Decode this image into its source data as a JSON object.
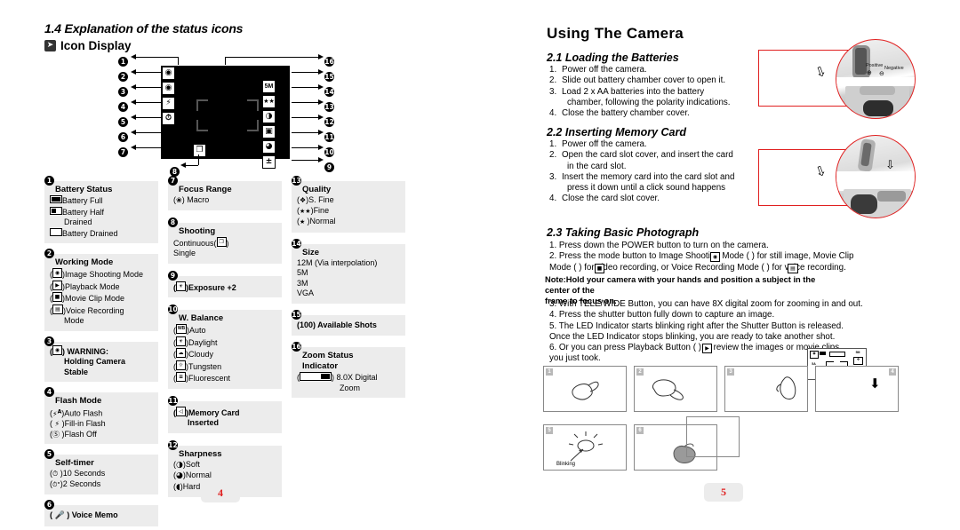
{
  "left_page": {
    "section_title": "1.4 Explanation of the status icons",
    "subsection_icon_name": "book-icon",
    "subsection_title": "Icon Display",
    "lcd": {
      "left_icons": [
        "camera-icon",
        "hand-shake-camera-icon",
        "flash-auto-icon",
        "self-timer-icon"
      ],
      "left_icon_labels": [
        "■",
        "■",
        "᭺",
        "◔"
      ],
      "right_icon_labels": [
        "5M",
        "★★",
        "◑",
        "◧",
        "◕",
        "±"
      ],
      "bottom_icon_label": "❐",
      "callouts": [
        "1",
        "2",
        "3",
        "4",
        "5",
        "6",
        "7",
        "8",
        "9",
        "10",
        "11",
        "12",
        "13",
        "14",
        "15",
        "16"
      ]
    },
    "page_number": "4",
    "legend": [
      {
        "num": "1",
        "title": "Battery Status",
        "rows": [
          {
            "icon": "battery-full-icon",
            "icon_fill": 100,
            "text": "Battery Full"
          },
          {
            "icon": "battery-half-icon",
            "icon_fill": 50,
            "text": "Battery Half"
          },
          {
            "icon": "",
            "indent": true,
            "text": "Drained"
          },
          {
            "icon": "battery-empty-icon",
            "icon_fill": 0,
            "text": "Battery Drained"
          }
        ]
      },
      {
        "num": "2",
        "title": "Working Mode",
        "rows": [
          {
            "icon": "image-shooting-mode-icon",
            "glyph": "■",
            "text": "Image Shooting Mode"
          },
          {
            "icon": "playback-mode-icon",
            "glyph": "▶",
            "text": "Playback  Mode"
          },
          {
            "icon": "movie-clip-mode-icon",
            "glyph": "Ἲ5",
            "text": "Movie Clip Mode"
          },
          {
            "icon": "voice-recording-mode-icon",
            "glyph": "▭",
            "text": "Voice Recording"
          },
          {
            "icon": "",
            "indent": true,
            "text": "Mode"
          }
        ]
      },
      {
        "num": "3",
        "title": "WARNING:",
        "title_icon": "holding-camera-warning-icon",
        "title_inline": true,
        "rows": [
          {
            "icon": "",
            "indent": true,
            "bold": true,
            "text": "Holding Camera"
          },
          {
            "icon": "",
            "indent": true,
            "bold": true,
            "text": "Stable"
          }
        ]
      },
      {
        "num": "4",
        "title": "Flash Mode",
        "rows": [
          {
            "icon": "flash-auto-icon",
            "glyph": "⚡A",
            "text": "Auto Flash",
            "plain": true
          },
          {
            "icon": "flash-fill-icon",
            "glyph": "⚡",
            "text": "Fill-in Flash",
            "plain": true
          },
          {
            "icon": "flash-off-icon",
            "glyph": "ⓘ",
            "text": "Flash Off",
            "plain": true
          }
        ]
      },
      {
        "num": "5",
        "title": "Self-timer",
        "rows": [
          {
            "icon": "timer-10s-icon",
            "glyph": "◴",
            "text": "10 Seconds",
            "plain": true
          },
          {
            "icon": "timer-2s-icon",
            "glyph": "◴\"",
            "text": "2 Seconds",
            "plain": true
          }
        ]
      },
      {
        "num": "6",
        "title": "Voice Memo",
        "title_icon": "microphone-icon",
        "title_inline": true,
        "rows": []
      },
      {
        "num": "7",
        "title": "Focus Range",
        "rows": [
          {
            "icon": "macro-flower-icon",
            "glyph": "❀",
            "text": " Macro",
            "plain": true
          }
        ]
      },
      {
        "num": "8",
        "title": "Shooting",
        "rows": [
          {
            "icon": "continuous-shooting-icon",
            "text": "Continuous",
            "suffix_icon": true,
            "suffix_glyph": "⧉"
          },
          {
            "icon": "",
            "text": "Single",
            "noparen": true
          }
        ]
      },
      {
        "num": "9",
        "title": "Exposure +2",
        "title_icon": "exposure-icon",
        "title_inline": true,
        "rows": []
      },
      {
        "num": "10",
        "title": "W. Balance",
        "rows": [
          {
            "icon": "wb-auto-icon",
            "glyph": "WB",
            "text": "Auto"
          },
          {
            "icon": "wb-daylight-icon",
            "glyph": "☀",
            "text": "Daylight"
          },
          {
            "icon": "wb-cloudy-icon",
            "glyph": "☁",
            "text": "Cloudy"
          },
          {
            "icon": "wb-tungsten-icon",
            "glyph": "Ὂ1",
            "text": "Tungsten"
          },
          {
            "icon": "wb-fluorescent-icon",
            "glyph": "≡",
            "text": "Fluorescent"
          }
        ]
      },
      {
        "num": "11",
        "title": "Memory Card",
        "title_icon": "memory-card-icon",
        "title_inline": true,
        "rows": [
          {
            "icon": "",
            "indent": true,
            "bold": true,
            "text": "Inserted"
          }
        ]
      },
      {
        "num": "12",
        "title": "Sharpness",
        "rows": [
          {
            "icon": "sharpness-soft-icon",
            "glyph": "◑",
            "text": "Soft"
          },
          {
            "icon": "sharpness-normal-icon",
            "glyph": "◔",
            "text": "Normal"
          },
          {
            "icon": "sharpness-hard-icon",
            "glyph": "◕",
            "text": "Hard"
          }
        ]
      },
      {
        "num": "13",
        "title": "Quality",
        "rows": [
          {
            "icon": "quality-super-fine-icon",
            "glyph": "✶",
            "text": "S. Fine"
          },
          {
            "icon": "quality-fine-icon",
            "glyph": "★★",
            "text": "Fine",
            "noborder": true
          },
          {
            "icon": "quality-normal-icon",
            "glyph": "★ ",
            "text": "Normal",
            "noborder": true
          }
        ]
      },
      {
        "num": "14",
        "title": "Size",
        "rows": [
          {
            "icon": "",
            "text": "12M (Via interpolation)",
            "noparen": true
          },
          {
            "icon": "",
            "text": "5M",
            "noparen": true
          },
          {
            "icon": "",
            "text": "3M",
            "noparen": true
          },
          {
            "icon": "",
            "text": "VGA",
            "noparen": true
          }
        ]
      },
      {
        "num": "15",
        "title": "(100) Available Shots",
        "title_plain": true,
        "rows": []
      },
      {
        "num": "16",
        "title": "Zoom Status",
        "rows": [
          {
            "icon": "",
            "indent": false,
            "bold": true,
            "text": "Indicator",
            "titlestyle": true
          },
          {
            "icon": "zoom-bar-icon",
            "zoombar": true,
            "text": " 8.0X Digital"
          },
          {
            "icon": "",
            "indent": true,
            "text": "Zoom",
            "extra_indent": true
          }
        ]
      }
    ]
  },
  "right_page": {
    "title": "Using The Camera",
    "page_number": "5",
    "sections": [
      {
        "heading": "2.1 Loading the Batteries",
        "items": [
          "Power off the camera.",
          "Slide out battery chamber cover to open it.",
          "Load 2 x AA batteries into the battery",
          "chamber, following the polarity indications.",
          "Close the battery chamber cover."
        ]
      },
      {
        "heading": "2.2 Inserting Memory Card",
        "items": [
          "Power off the camera.",
          "Open the card slot cover, and insert the card",
          "in the card slot.",
          "Insert the memory card into the card slot and",
          "press it down until a click sound happens",
          "Close the card slot cover."
        ]
      },
      {
        "heading": "2.3 Taking Basic Photograph"
      }
    ],
    "sec23_lines": [
      "1. Press down the POWER button to turn on the camera.",
      "2. Press the mode button to Image Shooting Mode (      ) for still image, Movie Clip",
      "    Mode (     ) for video recording, or Voice Recording Mode (     ) for voice recording."
    ],
    "note_lines": [
      "Note:Hold your camera with your hands and position a subject in the center of the",
      "        frame to focus on."
    ],
    "sec23_lines2": [
      "3. With TELE/WIDE Button, you can have 8X digital zoom for zooming in and out.",
      "4. Press the shutter button fully down to capture an image.",
      "5. The LED Indicator starts blinking right after the Shutter Button is released.",
      "    Once the LED Indicator stops blinking, you are ready to take another shot.",
      "6. Or you can press Playback Button (     ) to review the images or movie  clips",
      "    you just took."
    ],
    "photo1_labels": {
      "positive": "Positive",
      "negative": "Negative"
    },
    "panels": [
      {
        "num": "1",
        "content": "hand-holding-camera"
      },
      {
        "num": "2",
        "content": "hand-holding-camera"
      },
      {
        "num": "3",
        "content": "hand-pressing-shutter"
      },
      {
        "num": "4",
        "content": "lcd-focus-frame-arrow"
      },
      {
        "num": "5",
        "content": "led-blinking",
        "label": "Blinking"
      },
      {
        "num": "6",
        "content": "hand-playback-button"
      }
    ],
    "mini_lcd": {
      "icons_top": [
        "camera-icon",
        "battery-icon",
        "zoom-bar-icon"
      ],
      "icons_right": [
        "size-label",
        "quality-label"
      ],
      "icon_left_label": "5A",
      "size_label": "5M",
      "quality_label": "✶"
    }
  },
  "colors": {
    "page_number": "#e02020",
    "legend_bg": "#ececec",
    "accent_red": "#e02020"
  }
}
